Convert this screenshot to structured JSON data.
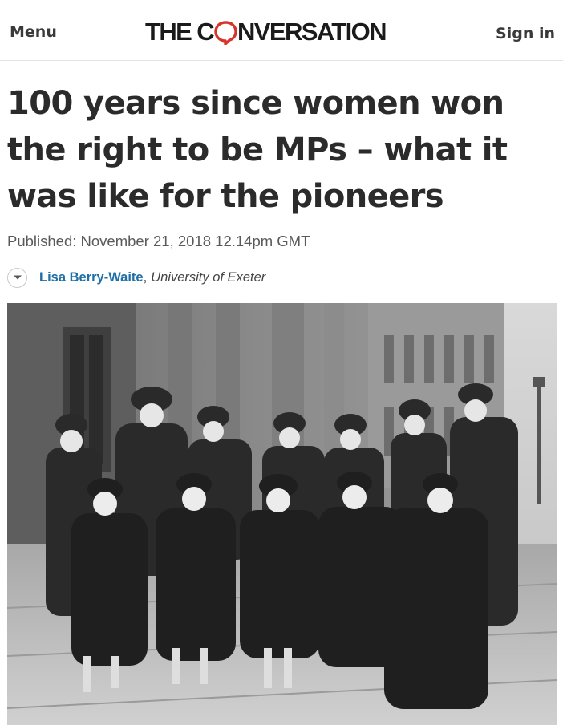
{
  "header": {
    "menu_label": "Menu",
    "logo_prefix": "THE C",
    "logo_suffix": "NVERSATION",
    "signin_label": "Sign in",
    "accent_color": "#d8352a"
  },
  "article": {
    "headline": "100 years since women won the right to be MPs – what it was like for the pioneers",
    "published": "Published: November 21, 2018 12.14pm GMT",
    "author": {
      "name": "Lisa Berry-Waite",
      "separator": ",",
      "affiliation": "University of Exeter",
      "toggle_icon": "chevron-down-icon"
    },
    "photo": {
      "icon": "photograph",
      "description_colors": [
        "#1c1c1c",
        "#8d8d8d",
        "#cfcfcf"
      ]
    }
  }
}
